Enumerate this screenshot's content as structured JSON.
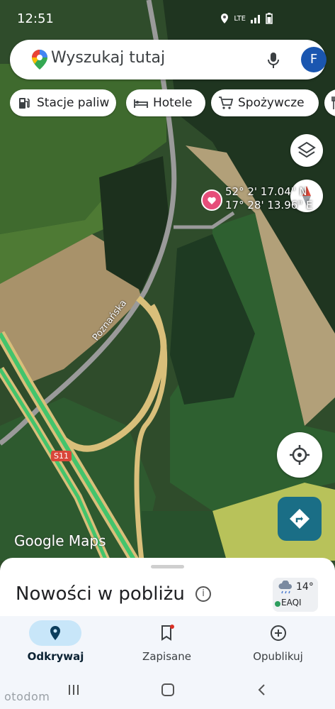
{
  "status_bar": {
    "time": "12:51",
    "network": "LTE",
    "icons": [
      "location-icon",
      "signal-icon",
      "battery-icon"
    ]
  },
  "search": {
    "placeholder": "Wyszukaj tutaj",
    "avatar_letter": "F"
  },
  "chips": [
    {
      "label": "Stacje paliw",
      "icon": "gas-station-icon"
    },
    {
      "label": "Hotele",
      "icon": "bed-icon"
    },
    {
      "label": "Spożywcze",
      "icon": "cart-icon"
    }
  ],
  "map": {
    "road_label": "Poznańska",
    "road_sign": "S11",
    "pin_lat": "52° 2' 17.04\" N",
    "pin_lon": "17° 28' 13.96\" E",
    "watermark": "Google Maps"
  },
  "sheet": {
    "title": "Nowości w pobliżu",
    "temperature": "14°",
    "air_quality": "EAQI"
  },
  "bottom_nav": [
    {
      "label": "Odkrywaj",
      "active": true
    },
    {
      "label": "Zapisane",
      "active": false
    },
    {
      "label": "Opublikuj",
      "active": false
    }
  ],
  "overlay": {
    "watermark": "otodom"
  },
  "colors": {
    "accent": "#1a56b0",
    "active_pill": "#c8e6f9",
    "heart": "#e64e7a",
    "directions": "#1a6e86"
  }
}
